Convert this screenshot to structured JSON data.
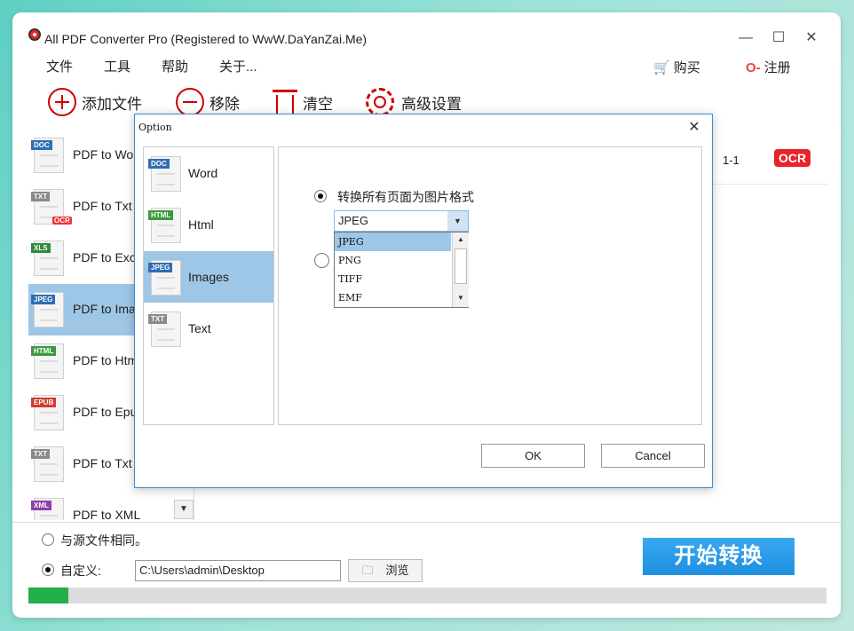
{
  "window": {
    "title": "All PDF Converter Pro (Registered to WwW.DaYanZai.Me)",
    "controls": {
      "minimize": "—",
      "maximize": "☐",
      "close": "✕"
    }
  },
  "menu": [
    "文件",
    "工具",
    "帮助",
    "关于..."
  ],
  "header_links": {
    "buy": "购买",
    "register": "注册"
  },
  "toolbar": {
    "add": "添加文件",
    "remove": "移除",
    "clear": "清空",
    "settings": "高级设置"
  },
  "sidebar": {
    "items": [
      {
        "label": "PDF to Word",
        "tag": "DOC",
        "tag_color": "#2f6db5"
      },
      {
        "label": "PDF to Txt",
        "tag": "TXT",
        "tag_color": "#8a8a8a",
        "ocr": "OCR"
      },
      {
        "label": "PDF to Excel",
        "tag": "XLS",
        "tag_color": "#2e8b3e"
      },
      {
        "label": "PDF to Images",
        "tag": "JPEG",
        "tag_color": "#2f6db5",
        "selected": true
      },
      {
        "label": "PDF to Html",
        "tag": "HTML",
        "tag_color": "#3c9a3c"
      },
      {
        "label": "PDF to Epub",
        "tag": "EPUB",
        "tag_color": "#d23b2e"
      },
      {
        "label": "PDF to Txt",
        "tag": "TXT",
        "tag_color": "#8a8a8a"
      },
      {
        "label": "PDF to XML",
        "tag": "XML",
        "tag_color": "#8e3fa8"
      }
    ],
    "scroll_down": "▼"
  },
  "file_row": {
    "pages": "1-1",
    "ocr": "OCR"
  },
  "output": {
    "same_as_source": "与源文件相同。",
    "custom": "自定义:",
    "path": "C:\\Users\\admin\\Desktop",
    "browse": "浏览"
  },
  "start_button": "开始转换",
  "progress": 0.05,
  "dialog": {
    "title": "Option",
    "close": "✕",
    "categories": [
      {
        "label": "Word",
        "tag": "DOC",
        "tag_color": "#2f6db5"
      },
      {
        "label": "Html",
        "tag": "HTML",
        "tag_color": "#3c9a3c"
      },
      {
        "label": "Images",
        "tag": "JPEG",
        "tag_color": "#2f6db5",
        "selected": true
      },
      {
        "label": "Text",
        "tag": "TXT",
        "tag_color": "#8a8a8a"
      }
    ],
    "option_all_pages": "转换所有页面为图片格式",
    "format_selected": "JPEG",
    "format_options": [
      "JPEG",
      "PNG",
      "TIFF",
      "EMF"
    ],
    "ok": "OK",
    "cancel": "Cancel"
  },
  "colors": {
    "accent": "#1e8fe0",
    "selection": "#9ec6e6",
    "progress": "#22b04a",
    "ocr": "#e8232a"
  }
}
